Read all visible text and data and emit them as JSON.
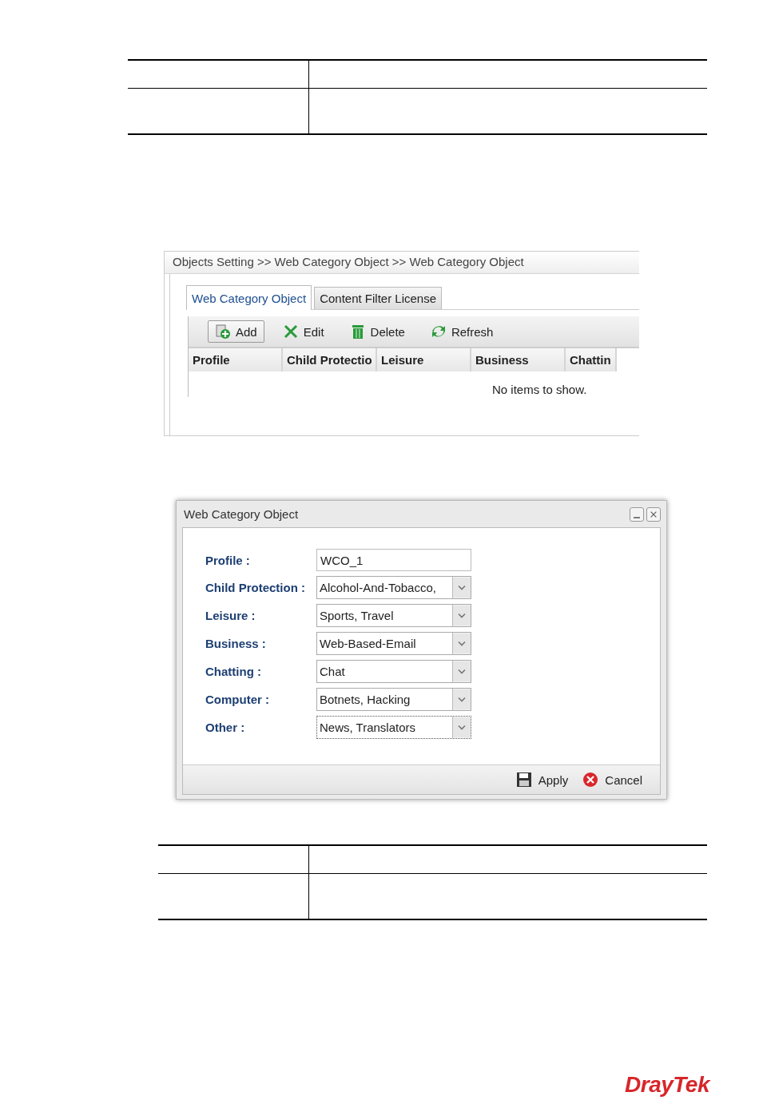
{
  "screenshot": {
    "breadcrumb": "Objects Setting >> Web Category Object >> Web Category Object",
    "tabs": [
      {
        "label": "Web Category Object",
        "selected": true
      },
      {
        "label": "Content Filter License",
        "selected": false
      }
    ],
    "toolbar": [
      {
        "label": "Add",
        "kind": "add",
        "highlighted": true
      },
      {
        "label": "Edit",
        "kind": "edit",
        "highlighted": false
      },
      {
        "label": "Delete",
        "kind": "delete",
        "highlighted": false
      },
      {
        "label": "Refresh",
        "kind": "refresh",
        "highlighted": false
      }
    ],
    "table": {
      "columns": [
        "Profile",
        "Child Protectio",
        "Leisure",
        "Business",
        "Chattin"
      ],
      "empty_message": "No items to show."
    }
  },
  "dialog": {
    "title": "Web Category Object",
    "fields": [
      {
        "label": "Profile :",
        "kind": "text",
        "value": "WCO_1",
        "focused": false
      },
      {
        "label": "Child Protection :",
        "kind": "select",
        "value": "Alcohol-And-Tobacco,",
        "focused": false
      },
      {
        "label": "Leisure :",
        "kind": "select",
        "value": "Sports, Travel",
        "focused": false
      },
      {
        "label": "Business :",
        "kind": "select",
        "value": "Web-Based-Email",
        "focused": false
      },
      {
        "label": "Chatting :",
        "kind": "select",
        "value": "Chat",
        "focused": false
      },
      {
        "label": "Computer :",
        "kind": "select",
        "value": "Botnets, Hacking",
        "focused": false
      },
      {
        "label": "Other :",
        "kind": "select",
        "value": "News, Translators",
        "focused": true
      }
    ],
    "buttons": [
      {
        "label": "Apply",
        "kind": "apply"
      },
      {
        "label": "Cancel",
        "kind": "cancel"
      }
    ]
  },
  "logo": "DrayTek"
}
